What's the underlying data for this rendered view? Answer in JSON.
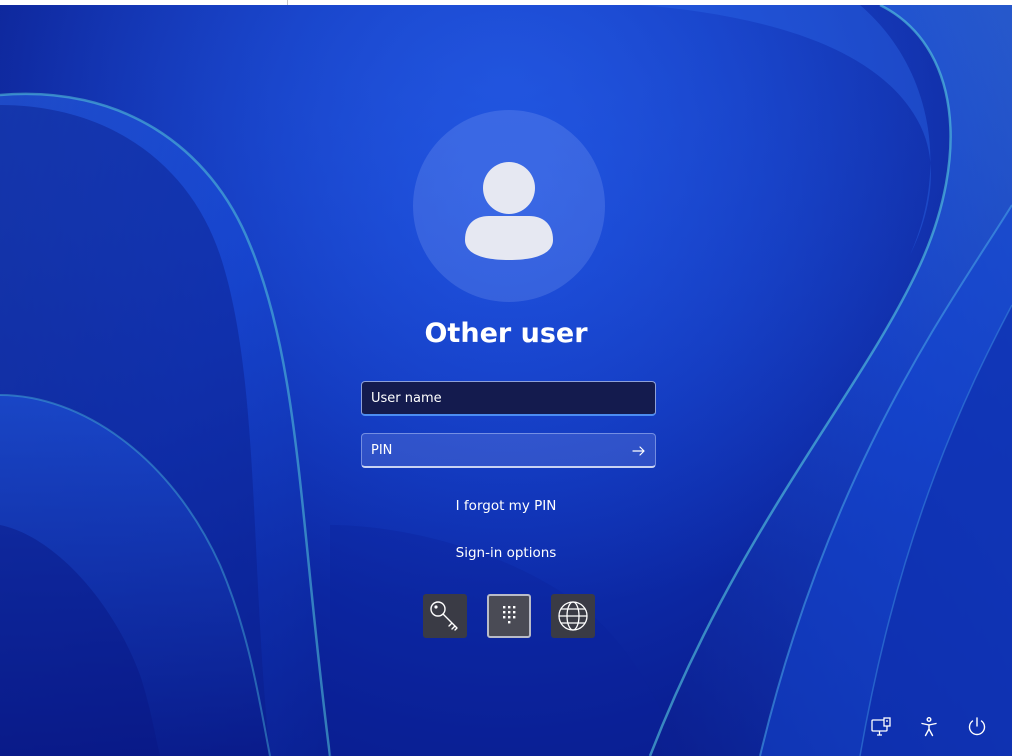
{
  "login": {
    "user_display_name": "Other user",
    "username_field": {
      "placeholder": "User name",
      "value": ""
    },
    "pin_field": {
      "placeholder": "PIN",
      "value": ""
    },
    "forgot_pin_link": "I forgot my PIN",
    "signin_options_link": "Sign-in options",
    "signin_options": [
      {
        "name": "password",
        "icon": "key-icon",
        "selected": false
      },
      {
        "name": "pin",
        "icon": "keypad-icon",
        "selected": true
      },
      {
        "name": "web-sign-in",
        "icon": "globe-icon",
        "selected": false
      }
    ]
  },
  "tray": {
    "icons": [
      "network-icon",
      "accessibility-icon",
      "power-icon"
    ]
  },
  "colors": {
    "background_blue": "#0f33b8",
    "field_focus_accent": "#4c8df2",
    "text": "#ffffff"
  }
}
